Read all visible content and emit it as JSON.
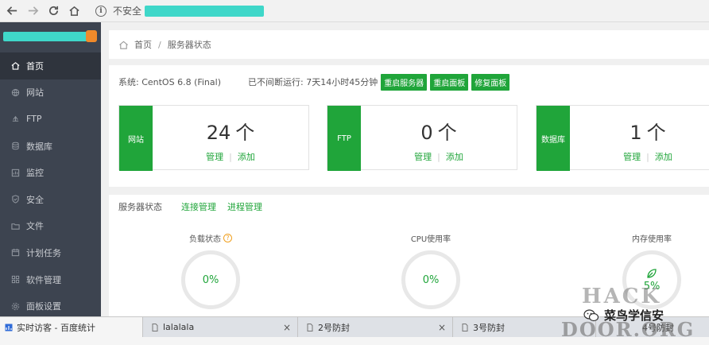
{
  "browser": {
    "address_label": "不安全"
  },
  "sidebar": {
    "items": [
      {
        "label": "首页",
        "icon": "home-icon"
      },
      {
        "label": "网站",
        "icon": "globe-icon"
      },
      {
        "label": "FTP",
        "icon": "ftp-icon"
      },
      {
        "label": "数据库",
        "icon": "database-icon"
      },
      {
        "label": "监控",
        "icon": "monitor-icon"
      },
      {
        "label": "安全",
        "icon": "shield-icon"
      },
      {
        "label": "文件",
        "icon": "folder-icon"
      },
      {
        "label": "计划任务",
        "icon": "calendar-icon"
      },
      {
        "label": "软件管理",
        "icon": "apps-icon"
      },
      {
        "label": "面板设置",
        "icon": "gear-icon"
      }
    ]
  },
  "breadcrumb": {
    "home": "首页",
    "current": "服务器状态"
  },
  "system": {
    "os": "系统: CentOS 6.8 (Final)",
    "uptime": "已不间断运行: 7天14小时45分钟",
    "buttons": [
      "重启服务器",
      "重启面板",
      "修复面板"
    ]
  },
  "stats": [
    {
      "tag": "网站",
      "count": "24",
      "unit": "个",
      "manage": "管理",
      "add": "添加"
    },
    {
      "tag": "FTP",
      "count": "0",
      "unit": "个",
      "manage": "管理",
      "add": "添加"
    },
    {
      "tag": "数据库",
      "count": "1",
      "unit": "个",
      "manage": "管理",
      "add": "添加"
    }
  ],
  "server_status": {
    "title": "服务器状态",
    "links": [
      "连接管理",
      "进程管理"
    ],
    "metrics": [
      {
        "label": "负载状态",
        "value": "0%"
      },
      {
        "label": "CPU使用率",
        "value": "0%"
      },
      {
        "label": "内存使用率",
        "value": "5%"
      }
    ]
  },
  "tabs": [
    {
      "label": "实时访客 - 百度统计",
      "active": true
    },
    {
      "label": "lalalala",
      "active": false
    },
    {
      "label": "2号防封",
      "active": false
    },
    {
      "label": "3号防封",
      "active": false
    },
    {
      "label": "4号防封",
      "active": false
    }
  ],
  "tab_close_glyph": "×",
  "watermark": {
    "line1": "HACK",
    "line2": "DOOR.ORG",
    "wechat": "菜鸟学信安"
  },
  "colors": {
    "accent": "#20a53a",
    "sidebar_bg": "#3d4450",
    "warning": "#f0a020"
  }
}
